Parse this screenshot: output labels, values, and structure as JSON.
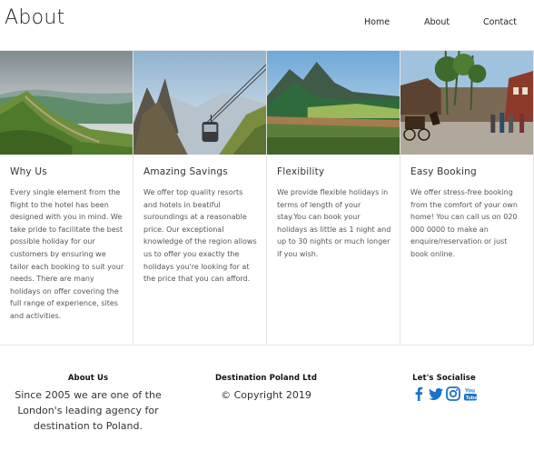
{
  "header": {
    "title": "About",
    "nav": {
      "home": "Home",
      "about": "About",
      "contact": "Contact"
    }
  },
  "cards": [
    {
      "title": "Why Us",
      "text": "Every single element from the flight to the hotel has been designed with you in mind. We take pride to facilitate the best possible holiday for our customers by ensuring we tailor each booking to suit your needs. There are many holidays on offer covering the full range of experience, sites and activities."
    },
    {
      "title": "Amazing Savings",
      "text": "We offer top quality resorts and hotels in beatiful suroundings at a reasonable price. Our exceptional knowledge of the region allows us to offer you exactly the holidays you're looking for at the price that you can afford."
    },
    {
      "title": "Flexibility",
      "text": "We provide flexible holidays in terms of length of your stay.You can book your holidays as little as 1 night and up to 30 nights or much longer if you wish."
    },
    {
      "title": "Easy Booking",
      "text": "We offer stress-free booking from the comfort of your own home! You can call us on 020 000 0000 to make an enquire/reservation or just book online."
    }
  ],
  "footer": {
    "about": {
      "heading": "About Us",
      "text": "Since 2005 we are one of the London's leading agency for destination to Poland."
    },
    "company": {
      "heading": "Destination Poland Ltd",
      "text": "© Copyright 2019"
    },
    "social": {
      "heading": "Let's Socialise",
      "icons": [
        "facebook-icon",
        "twitter-icon",
        "instagram-icon",
        "youtube-icon"
      ],
      "color": "#1a73c9"
    }
  }
}
